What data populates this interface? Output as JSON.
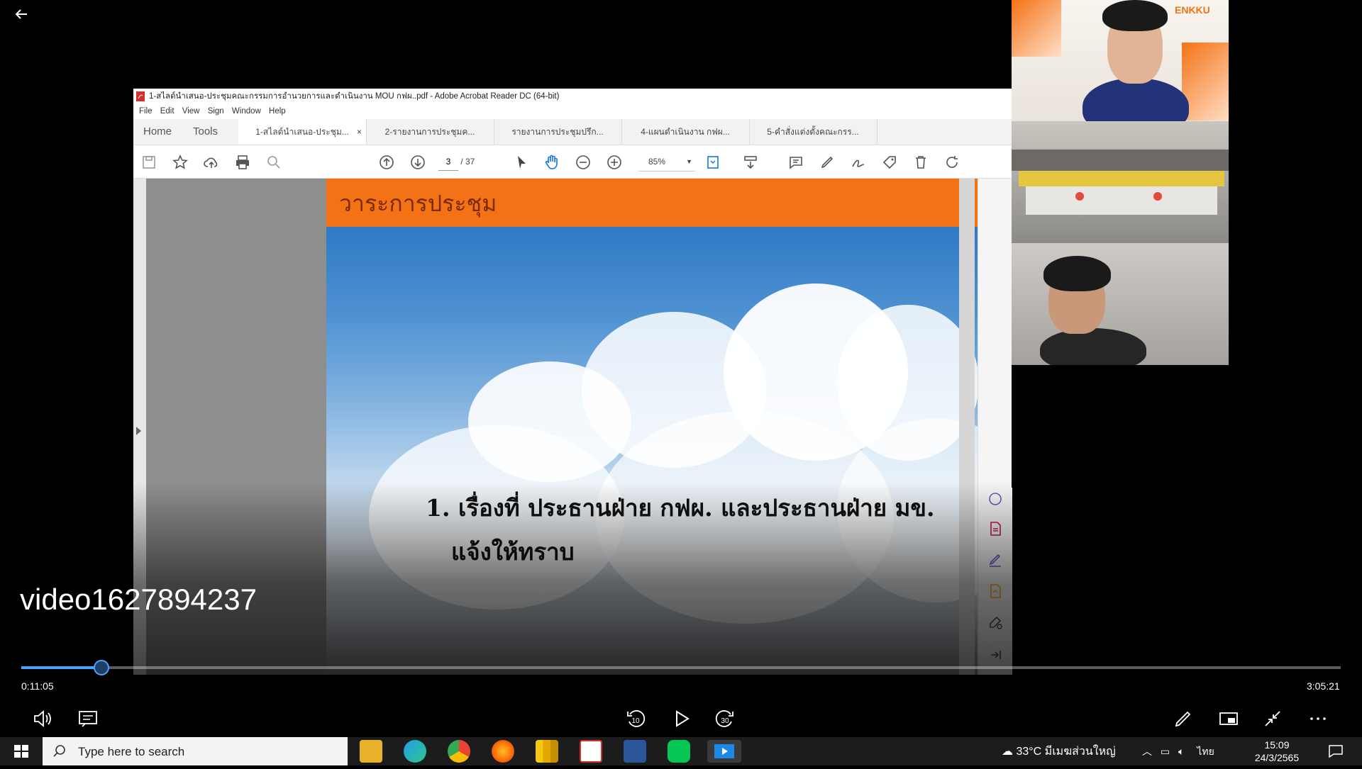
{
  "player": {
    "video_title": "video1627894237",
    "current_time": "0:11:05",
    "duration": "3:05:21",
    "progress": 0.0605,
    "skip_back_seconds": "10",
    "skip_forward_seconds": "30",
    "accent_color": "#4ba3ff"
  },
  "acrobat": {
    "window_title": "1-สไลด์นำเสนอ-ประชุมคณะกรรมการอำนวยการและดำเนินงาน MOU กฟผ..pdf - Adobe Acrobat Reader DC (64-bit)",
    "menu": [
      "File",
      "Edit",
      "View",
      "Sign",
      "Window",
      "Help"
    ],
    "home_tab": "Home",
    "tools_tab": "Tools",
    "tabs": [
      {
        "label": "1-สไลด์นำเสนอ-ประชุม...",
        "close": "×"
      },
      {
        "label": "2-รายงานการประชุมค..."
      },
      {
        "label": "รายงานการประชุมปรึก..."
      },
      {
        "label": "4-แผนดำเนินงาน กฟผ..."
      },
      {
        "label": "5-คำสั่งแต่งตั้งคณะกรร..."
      }
    ],
    "page_current": "3",
    "page_total": "/ 37",
    "zoom": "85%",
    "slide": {
      "title": "วาระการประชุม",
      "line1": "1. เรื่องที่ ประธานฝ่าย กฟผ. และประธานฝ่าย มข.",
      "line2": "แจ้งให้ทราบ"
    }
  },
  "participants": {
    "logo_text": "ENKKU"
  },
  "taskbar": {
    "search_placeholder": "Type here to search",
    "weather": "33°C  มีเมฆส่วนใหญ่",
    "language": "ไทย",
    "time": "15:09",
    "date": "24/3/2565"
  }
}
